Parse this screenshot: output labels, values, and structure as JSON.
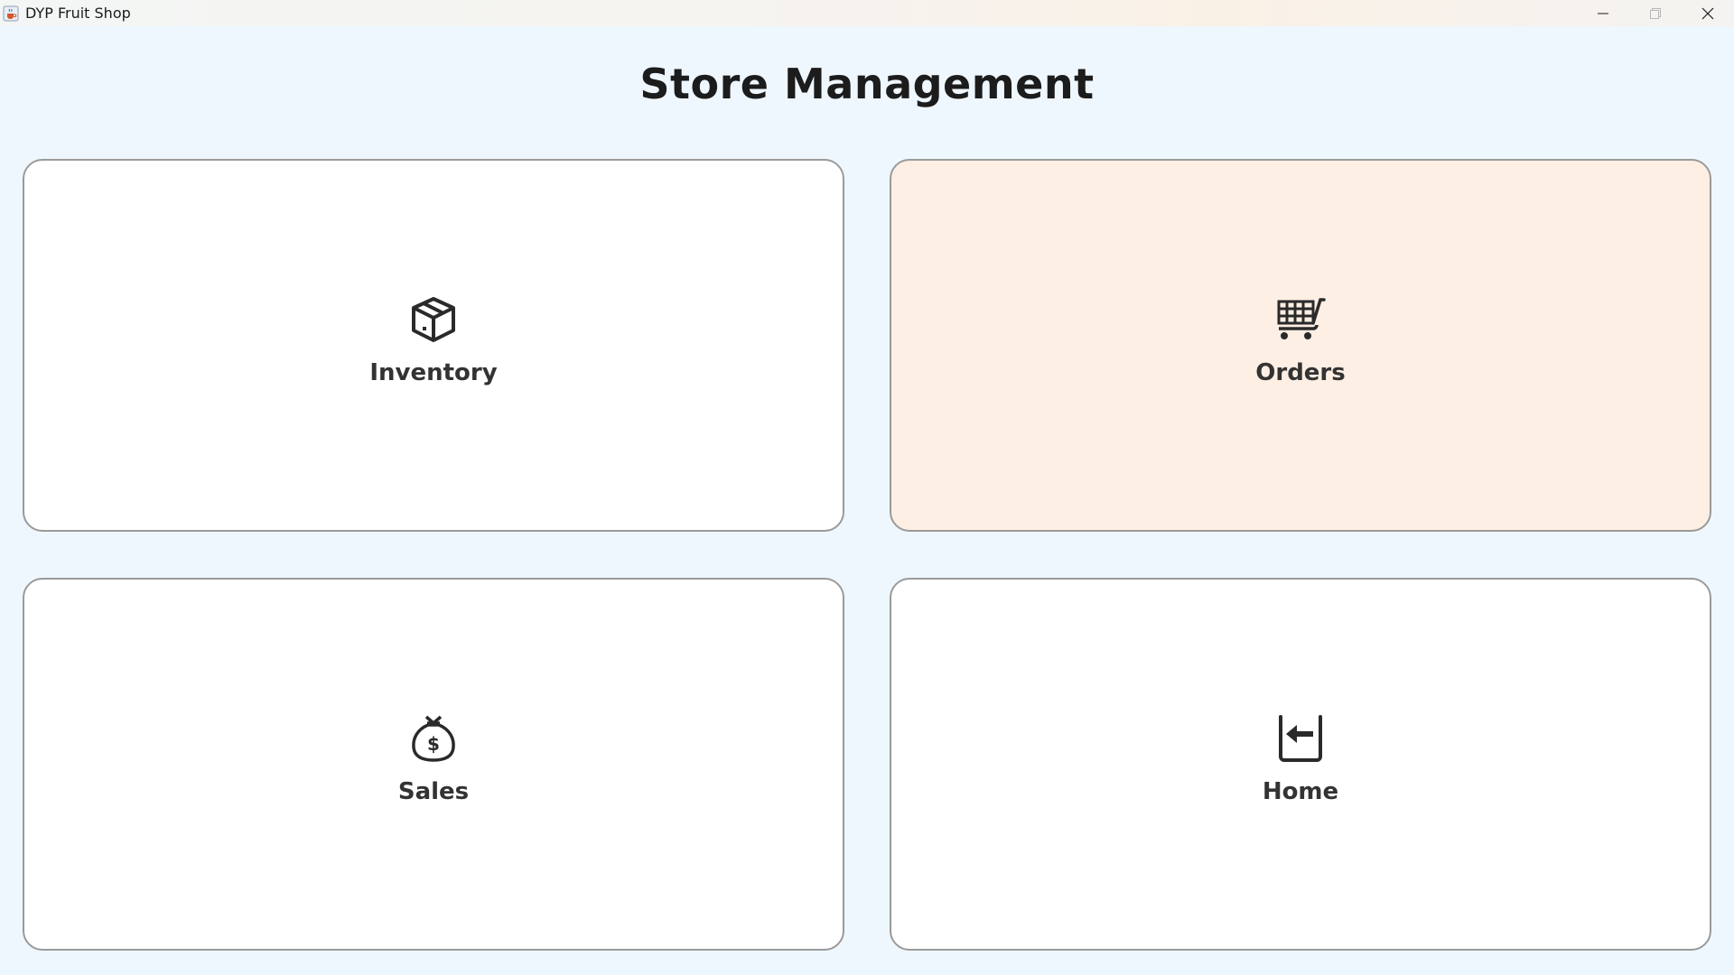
{
  "window": {
    "title": "DYP Fruit Shop",
    "icon": "java-cup-icon"
  },
  "page": {
    "title": "Store Management"
  },
  "cards": [
    {
      "label": "Inventory",
      "icon": "package-icon"
    },
    {
      "label": "Orders",
      "icon": "shopping-cart-icon",
      "highlighted": true,
      "highlight_color": "#feefe4"
    },
    {
      "label": "Sales",
      "icon": "money-bag-icon"
    },
    {
      "label": "Home",
      "icon": "exit-arrow-icon"
    }
  ],
  "colors": {
    "background": "#eff7fe",
    "card": "#ffffff",
    "card_border": "#9a9a9a",
    "text": "#333333"
  }
}
